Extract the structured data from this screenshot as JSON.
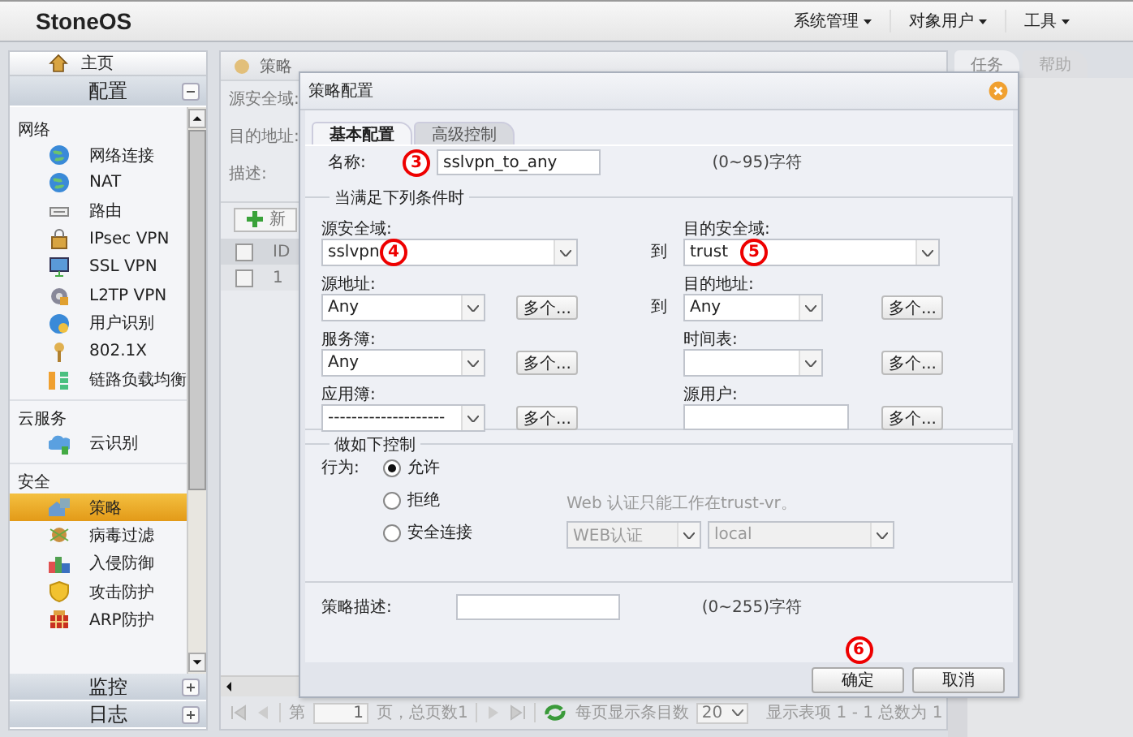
{
  "topbar": {
    "logo": "StoneOS",
    "menus": [
      {
        "label": "系统管理"
      },
      {
        "label": "对象用户"
      },
      {
        "label": "工具"
      }
    ]
  },
  "sidebar": {
    "home": "主页",
    "sections": [
      {
        "title": "配置",
        "expanded": true,
        "groups": [
          {
            "title": "网络",
            "items": [
              {
                "label": "网络连接",
                "selected": false
              },
              {
                "label": "NAT",
                "selected": false
              },
              {
                "label": "路由",
                "selected": false
              },
              {
                "label": "IPsec VPN",
                "selected": false
              },
              {
                "label": "SSL VPN",
                "selected": false
              },
              {
                "label": "L2TP VPN",
                "selected": false
              },
              {
                "label": "用户识别",
                "selected": false
              },
              {
                "label": "802.1X",
                "selected": false
              },
              {
                "label": "链路负载均衡",
                "selected": false
              }
            ]
          },
          {
            "title": "云服务",
            "items": [
              {
                "label": "云识别",
                "selected": false
              }
            ]
          },
          {
            "title": "安全",
            "items": [
              {
                "label": "策略",
                "selected": true
              },
              {
                "label": "病毒过滤",
                "selected": false
              },
              {
                "label": "入侵防御",
                "selected": false
              },
              {
                "label": "攻击防护",
                "selected": false
              },
              {
                "label": "ARP防护",
                "selected": false
              }
            ]
          }
        ]
      },
      {
        "title": "监控",
        "expanded": false
      },
      {
        "title": "日志",
        "expanded": false
      }
    ]
  },
  "main": {
    "title": "策略",
    "filters": [
      "源安全域:",
      "目的地址:",
      "描述:"
    ],
    "new_button": "新",
    "table": {
      "all_checked": false,
      "columns": [
        "ID"
      ],
      "rows": [
        {
          "checked": false,
          "cells": [
            "1"
          ]
        }
      ]
    },
    "pagination": {
      "page_label": "第",
      "page": "1",
      "total_pages": "页，总页数1",
      "per_page_label": "每页显示条目数",
      "per_page": "20",
      "summary": "显示表项 1 - 1 总数为 1"
    }
  },
  "right_tabs": [
    {
      "label": "任务",
      "selected": true
    },
    {
      "label": "帮助",
      "selected": false
    }
  ],
  "dialog": {
    "title": "策略配置",
    "tabs": [
      {
        "label": "基本配置",
        "selected": true
      },
      {
        "label": "高级控制",
        "selected": false
      }
    ],
    "name": {
      "label": "名称:",
      "value": "sslvpn_to_any",
      "hint": "(0~95)字符",
      "annotation": "3"
    },
    "conditions": {
      "title": "当满足下列条件时",
      "rows": [
        {
          "left": {
            "label": "源安全域:",
            "kind": "select",
            "value": "sslvpn",
            "annotation": "4"
          },
          "connector": "到",
          "right": {
            "label": "目的安全域:",
            "kind": "select",
            "value": "trust",
            "annotation": "5"
          }
        },
        {
          "left": {
            "label": "源地址:",
            "kind": "select",
            "value": "Any",
            "more": "多个..."
          },
          "connector": "到",
          "right": {
            "label": "目的地址:",
            "kind": "select",
            "value": "Any",
            "more": "多个..."
          }
        },
        {
          "left": {
            "label": "服务簿:",
            "kind": "select",
            "value": "Any",
            "more": "多个..."
          },
          "right": {
            "label": "时间表:",
            "kind": "select",
            "more": "多个..."
          }
        },
        {
          "left": {
            "label": "应用簿:",
            "kind": "select",
            "value": "--------------------",
            "more": "多个..."
          },
          "right": {
            "label": "源用户:",
            "kind": "text",
            "more": "多个..."
          }
        }
      ]
    },
    "control": {
      "title": "做如下控制",
      "action_label": "行为:",
      "options": [
        {
          "label": "允许",
          "selected": true
        },
        {
          "label": "拒绝",
          "selected": false
        },
        {
          "label": "安全连接",
          "selected": false
        }
      ],
      "note": "Web 认证只能工作在trust-vr。",
      "auth_selects": [
        {
          "value": "WEB认证",
          "disabled": true
        },
        {
          "value": "local",
          "disabled": true
        }
      ]
    },
    "description": {
      "label": "策略描述:",
      "hint": "(0~255)字符"
    },
    "buttons": [
      {
        "label": "确定",
        "annotation": "6"
      },
      {
        "label": "取消"
      }
    ]
  }
}
